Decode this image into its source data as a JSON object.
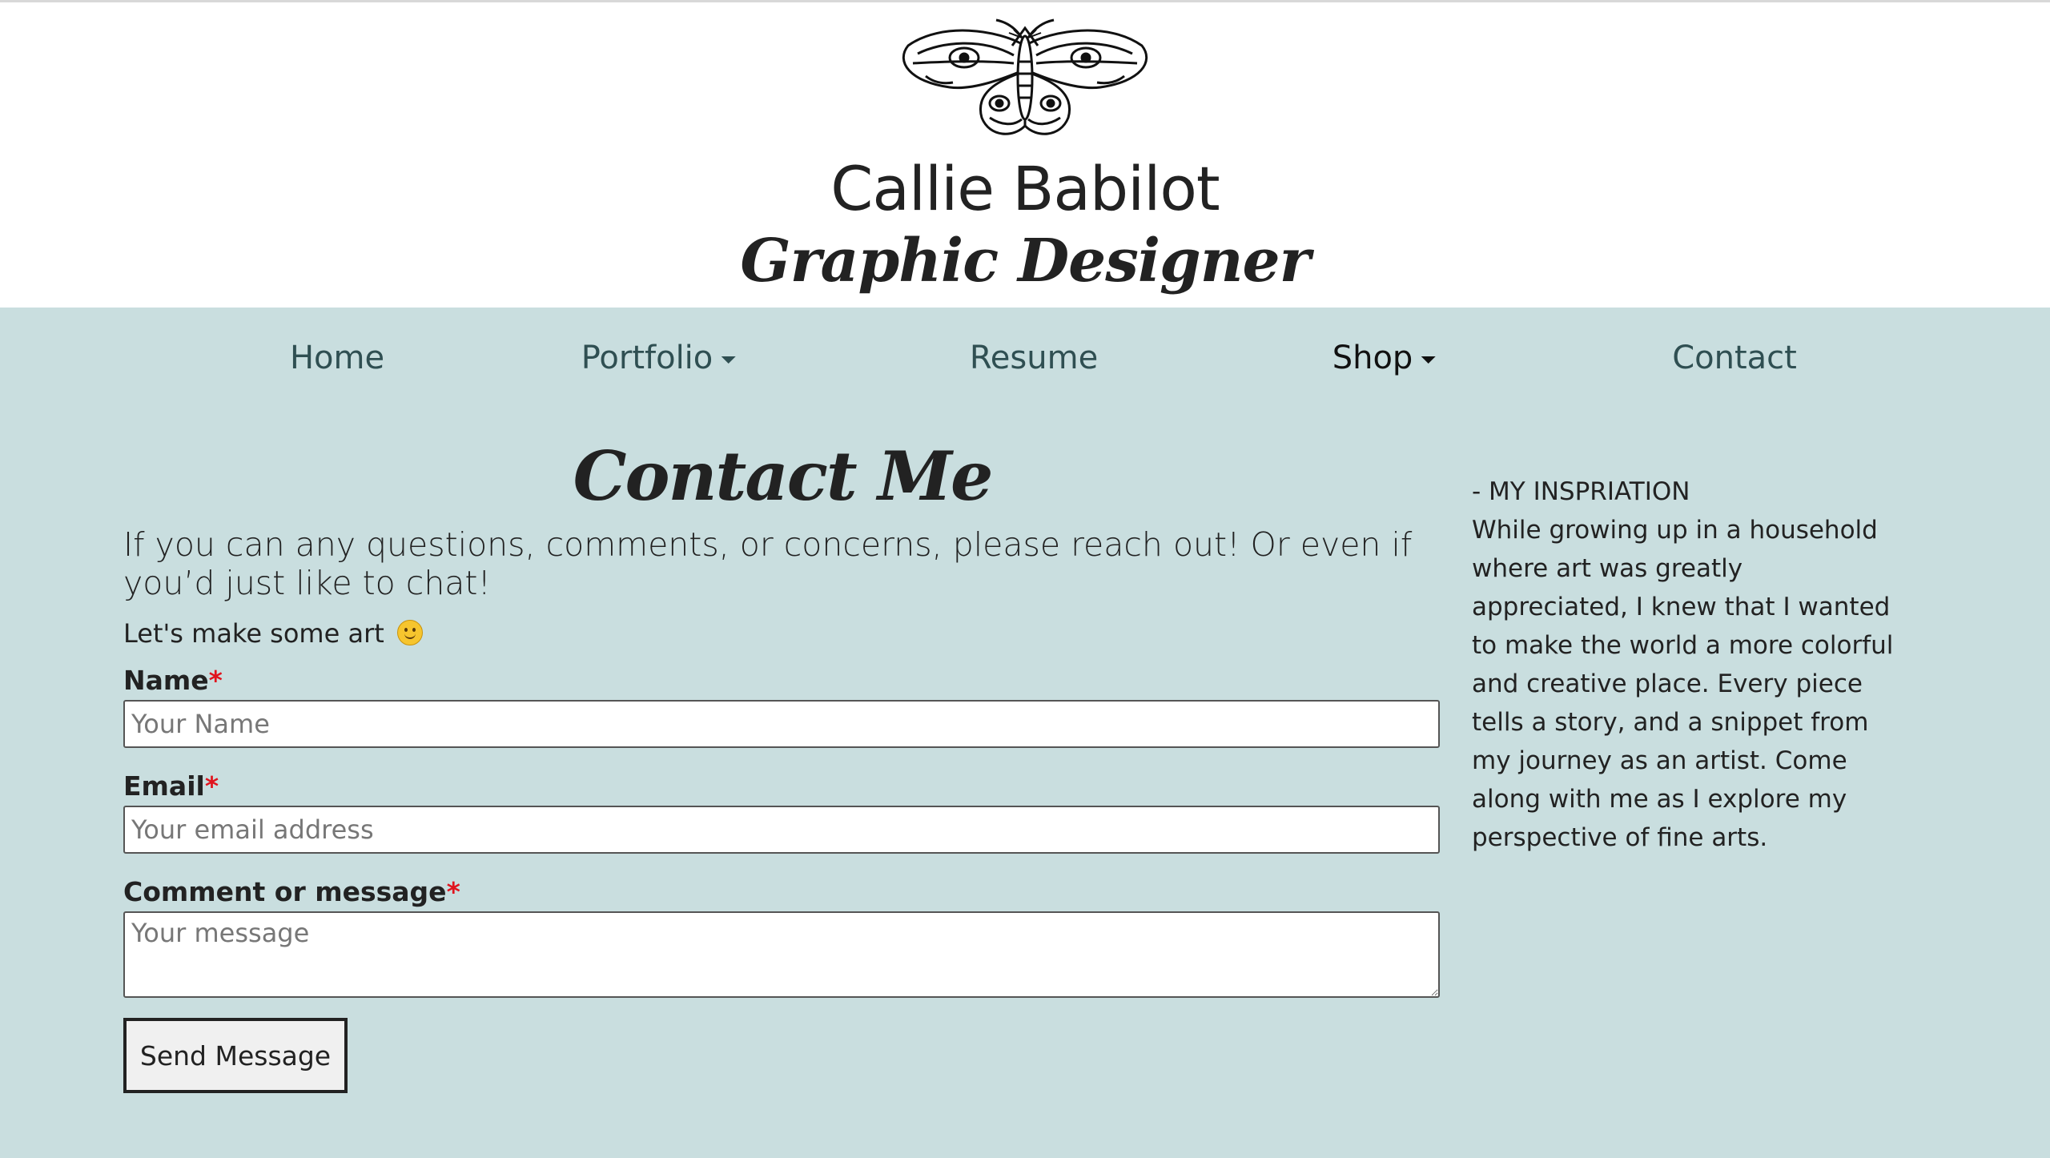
{
  "header": {
    "logo_icon": "moth-icon",
    "site_name": "Callie Babilot",
    "tagline": "Graphic Designer"
  },
  "nav": {
    "items": [
      {
        "label": "Home",
        "has_dropdown": false
      },
      {
        "label": "Portfolio",
        "has_dropdown": true
      },
      {
        "label": "Resume",
        "has_dropdown": false
      },
      {
        "label": "Shop",
        "has_dropdown": true,
        "active": true
      },
      {
        "label": "Contact",
        "has_dropdown": false
      }
    ]
  },
  "main": {
    "title": "Contact Me",
    "intro": "If you can any questions, comments, or concerns, please reach out! Or even if you’d just like to chat!",
    "sub_intro": "Let's make some art",
    "emoji_icon": "smiley-face-icon",
    "form": {
      "name_label": "Name",
      "name_placeholder": "Your Name",
      "name_value": "",
      "email_label": "Email",
      "email_placeholder": "Your email address",
      "email_value": "",
      "message_label": "Comment or message",
      "message_placeholder": "Your message",
      "message_value": "",
      "required_marker": "*",
      "submit_label": "Send Message"
    }
  },
  "sidebar": {
    "heading": "- MY INSPRIATION",
    "body": "While growing up in a household where art was greatly appreciated, I knew that I wanted to make the world a more colorful and creative place. Every piece tells a story, and a snippet from my journey as an artist. Come along with me as I explore my perspective of fine arts."
  },
  "colors": {
    "page_background": "#c9dedf",
    "header_background": "#ffffff",
    "nav_link": "#2f4f52",
    "text": "#222222",
    "required": "#e0141e"
  }
}
